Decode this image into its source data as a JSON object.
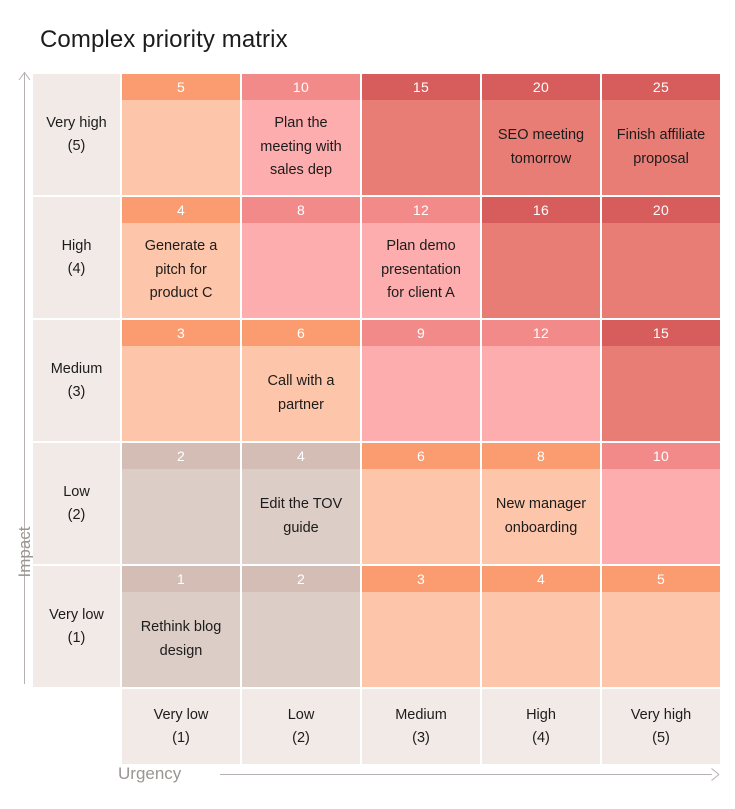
{
  "page": {
    "title": "Complex priority matrix",
    "background": "#ffffff"
  },
  "axes": {
    "y": {
      "label": "Impact",
      "direction": "up",
      "color": "#9a9592",
      "categories": [
        {
          "name": "Very high",
          "value": "(5)"
        },
        {
          "name": "High",
          "value": "(4)"
        },
        {
          "name": "Medium",
          "value": "(3)"
        },
        {
          "name": "Low",
          "value": "(2)"
        },
        {
          "name": "Very low",
          "value": "(1)"
        }
      ]
    },
    "x": {
      "label": "Urgency",
      "direction": "right",
      "color": "#9a9592",
      "categories": [
        {
          "name": "Very low",
          "value": "(1)"
        },
        {
          "name": "Low",
          "value": "(2)"
        },
        {
          "name": "Medium",
          "value": "(3)"
        },
        {
          "name": "High",
          "value": "(4)"
        },
        {
          "name": "Very high",
          "value": "(5)"
        }
      ]
    }
  },
  "palette": {
    "label_cell": "#f2eae7",
    "taupe_head": "#d4bdb4",
    "taupe_body": "#ddcdc7",
    "peach_head": "#fa9c70",
    "peach_body": "#fdc5a9",
    "pink_head": "#f28a8a",
    "pink_body": "#fdadae",
    "red_head": "#d75c5c",
    "red_body": "#e87d76",
    "score_text": "#ffffff",
    "task_text": "#1c1c1c",
    "title_text": "#1c1c1c"
  },
  "chart_data": {
    "type": "heatmap",
    "title": "Complex priority matrix",
    "xlabel": "Urgency",
    "ylabel": "Impact",
    "grid": true,
    "legend": "none",
    "x": [
      "Very low (1)",
      "Low (2)",
      "Medium (3)",
      "High (4)",
      "Very high (5)"
    ],
    "y": [
      "Very high (5)",
      "High (4)",
      "Medium (3)",
      "Low (2)",
      "Very low (1)"
    ],
    "values": [
      [
        5,
        10,
        15,
        20,
        25
      ],
      [
        4,
        8,
        12,
        16,
        20
      ],
      [
        3,
        6,
        9,
        12,
        15
      ],
      [
        2,
        4,
        6,
        8,
        10
      ],
      [
        1,
        2,
        3,
        4,
        5
      ]
    ],
    "annotations": [
      {
        "row": 0,
        "col": 1,
        "text": "Plan the meeting with sales dep"
      },
      {
        "row": 0,
        "col": 3,
        "text": "SEO meeting tomorrow"
      },
      {
        "row": 0,
        "col": 4,
        "text": "Finish affiliate proposal"
      },
      {
        "row": 1,
        "col": 0,
        "text": "Generate a pitch for product C"
      },
      {
        "row": 1,
        "col": 2,
        "text": "Plan demo presentation for client A"
      },
      {
        "row": 2,
        "col": 1,
        "text": "Call with a partner"
      },
      {
        "row": 3,
        "col": 1,
        "text": "Edit the TOV guide"
      },
      {
        "row": 3,
        "col": 3,
        "text": "New manager onboarding"
      },
      {
        "row": 4,
        "col": 0,
        "text": "Rethink blog design"
      }
    ]
  },
  "matrix": {
    "rows": [
      {
        "label": "Very high",
        "sublabel": "(5)",
        "cells": [
          {
            "score": "5",
            "task": "",
            "head": "#fa9c70",
            "body": "#fdc5a9"
          },
          {
            "score": "10",
            "task": "Plan the meeting with sales dep",
            "head": "#f28a8a",
            "body": "#fdadae"
          },
          {
            "score": "15",
            "task": "",
            "head": "#d75c5c",
            "body": "#e87d76"
          },
          {
            "score": "20",
            "task": "SEO meeting tomorrow",
            "head": "#d75c5c",
            "body": "#e87d76"
          },
          {
            "score": "25",
            "task": "Finish affiliate proposal",
            "head": "#d75c5c",
            "body": "#e87d76"
          }
        ]
      },
      {
        "label": "High",
        "sublabel": "(4)",
        "cells": [
          {
            "score": "4",
            "task": "Generate a pitch for product C",
            "head": "#fa9c70",
            "body": "#fdc5a9"
          },
          {
            "score": "8",
            "task": "",
            "head": "#f28a8a",
            "body": "#fdadae"
          },
          {
            "score": "12",
            "task": "Plan demo presentation for client A",
            "head": "#f28a8a",
            "body": "#fdadae"
          },
          {
            "score": "16",
            "task": "",
            "head": "#d75c5c",
            "body": "#e87d76"
          },
          {
            "score": "20",
            "task": "",
            "head": "#d75c5c",
            "body": "#e87d76"
          }
        ]
      },
      {
        "label": "Medium",
        "sublabel": "(3)",
        "cells": [
          {
            "score": "3",
            "task": "",
            "head": "#fa9c70",
            "body": "#fdc5a9"
          },
          {
            "score": "6",
            "task": "Call with a partner",
            "head": "#fa9c70",
            "body": "#fdc5a9"
          },
          {
            "score": "9",
            "task": "",
            "head": "#f28a8a",
            "body": "#fdadae"
          },
          {
            "score": "12",
            "task": "",
            "head": "#f28a8a",
            "body": "#fdadae"
          },
          {
            "score": "15",
            "task": "",
            "head": "#d75c5c",
            "body": "#e87d76"
          }
        ]
      },
      {
        "label": "Low",
        "sublabel": "(2)",
        "cells": [
          {
            "score": "2",
            "task": "",
            "head": "#d4bdb4",
            "body": "#ddcdc7"
          },
          {
            "score": "4",
            "task": "Edit the TOV guide",
            "head": "#d4bdb4",
            "body": "#ddcdc7"
          },
          {
            "score": "6",
            "task": "",
            "head": "#fa9c70",
            "body": "#fdc5a9"
          },
          {
            "score": "8",
            "task": "New manager onboarding",
            "head": "#fa9c70",
            "body": "#fdc5a9"
          },
          {
            "score": "10",
            "task": "",
            "head": "#f28a8a",
            "body": "#fdadae"
          }
        ]
      },
      {
        "label": "Very low",
        "sublabel": "(1)",
        "cells": [
          {
            "score": "1",
            "task": "Rethink blog design",
            "head": "#d4bdb4",
            "body": "#ddcdc7"
          },
          {
            "score": "2",
            "task": "",
            "head": "#d4bdb4",
            "body": "#ddcdc7"
          },
          {
            "score": "3",
            "task": "",
            "head": "#fa9c70",
            "body": "#fdc5a9"
          },
          {
            "score": "4",
            "task": "",
            "head": "#fa9c70",
            "body": "#fdc5a9"
          },
          {
            "score": "5",
            "task": "",
            "head": "#fa9c70",
            "body": "#fdc5a9"
          }
        ]
      }
    ]
  }
}
